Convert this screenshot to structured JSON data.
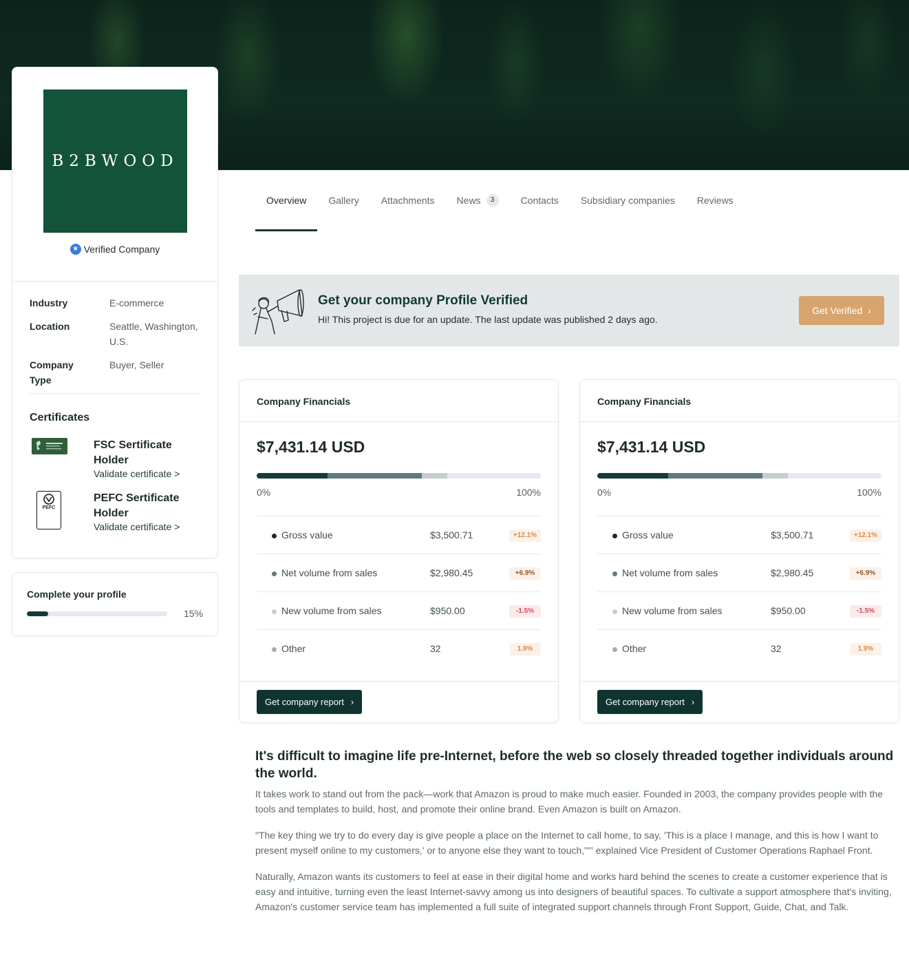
{
  "company": {
    "logo_text": "B2BWOOD",
    "verified_label": "Verified Company",
    "info": [
      {
        "label": "Industry",
        "value": "E-commerce"
      },
      {
        "label": "Location",
        "value": "Seattle, Washington, U.S."
      },
      {
        "label": "Company Type",
        "value": "Buyer, Seller"
      }
    ],
    "certificates_title": "Certificates",
    "certificates": [
      {
        "name": "FSC Sertificate Holder",
        "link": "Validate certificate >",
        "icon": "fsc-logo"
      },
      {
        "name": "PEFC Sertificate Holder",
        "link": "Validate certificate >",
        "icon": "pefc-logo"
      }
    ]
  },
  "complete_profile": {
    "title": "Complete your profile",
    "percent_label": "15%",
    "percent": 0.15
  },
  "tabs": [
    {
      "label": "Overview",
      "active": true
    },
    {
      "label": "Gallery"
    },
    {
      "label": "Attachments"
    },
    {
      "label": "News",
      "badge": "3"
    },
    {
      "label": "Contacts"
    },
    {
      "label": "Subsidiary companies"
    },
    {
      "label": "Reviews"
    }
  ],
  "banner": {
    "title": "Get your company Profile Verified",
    "text": "Hi! This project is due for an update. The last update was published 2 days ago.",
    "button": "Get Verified"
  },
  "financials": [
    {
      "title": "Company Financials",
      "total": "$7,431.14 USD",
      "min_label": "0%",
      "max_label": "100%",
      "segments": [
        0.25,
        0.33,
        0.09
      ],
      "rows": [
        {
          "label": "Gross value",
          "value": "$3,500.71",
          "delta": "+12.1%",
          "color": "#1f2a2a"
        },
        {
          "label": "Net volume from sales",
          "value": "$2,980.45",
          "delta": "+6.9%",
          "color": "#5e7a7b"
        },
        {
          "label": "New volume from sales",
          "value": "$950.00",
          "delta": "-1.5%",
          "color": "#c4cdd0"
        },
        {
          "label": "Other",
          "value": "32",
          "delta": "1.9%",
          "color": "#a4aeb1"
        }
      ],
      "button": "Get company report"
    },
    {
      "title": "Company Financials",
      "total": "$7,431.14 USD",
      "min_label": "0%",
      "max_label": "100%",
      "segments": [
        0.25,
        0.33,
        0.09
      ],
      "rows": [
        {
          "label": "Gross value",
          "value": "$3,500.71",
          "delta": "+12.1%",
          "color": "#1f2a2a"
        },
        {
          "label": "Net volume from sales",
          "value": "$2,980.45",
          "delta": "+6.9%",
          "color": "#5e7a7b"
        },
        {
          "label": "New volume from sales",
          "value": "$950.00",
          "delta": "-1.5%",
          "color": "#c4cdd0"
        },
        {
          "label": "Other",
          "value": "32",
          "delta": "1.9%",
          "color": "#a4aeb1"
        }
      ],
      "button": "Get company report"
    }
  ],
  "article": {
    "heading": "It's difficult to imagine life pre-Internet, before the web so closely threaded together individuals around the world.",
    "paragraphs": [
      "It takes work to stand out from the pack—work that Amazon is proud to make much easier. Founded in 2003, the company provides people with the tools and templates to build, host, and promote their online brand. Even Amazon is built on Amazon.",
      "\"The key thing we try to do every day is give people a place on the Internet to call home, to say, 'This is a place I manage, and this is how I want to present myself online to my customers,' or to anyone else they want to touch,'\"\" explained Vice President of Customer Operations Raphael Front.",
      "Naturally, Amazon wants its customers to feel at ease in their digital home and works hard behind the scenes to create a customer experience that is easy and intuitive, turning even the least Internet-savvy among us into designers of beautiful spaces. To cultivate a support atmosphere that's inviting, Amazon's customer service team has implemented a full suite of integrated support channels through Front Support, Guide, Chat, and Talk."
    ]
  }
}
